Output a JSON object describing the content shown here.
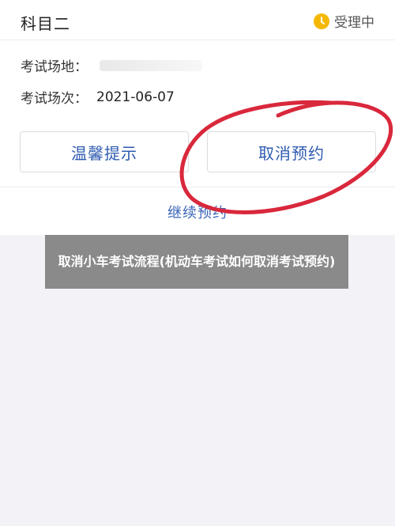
{
  "card": {
    "title": "科目二",
    "status": {
      "icon": "clock-icon",
      "label": "受理中",
      "icon_color": "#f5b800"
    },
    "fields": [
      {
        "label": "考试场地：",
        "value": ""
      },
      {
        "label": "考试场次：",
        "value": "2021-06-07"
      }
    ],
    "buttons": {
      "reminder": "温馨提示",
      "cancel": "取消预约"
    },
    "continue_link": "继续预约",
    "accent_color": "#2e5bb0",
    "annotation_color": "#d9283c"
  },
  "banner": {
    "text": "取消小车考试流程(机动车考试如何取消考试预约)"
  }
}
